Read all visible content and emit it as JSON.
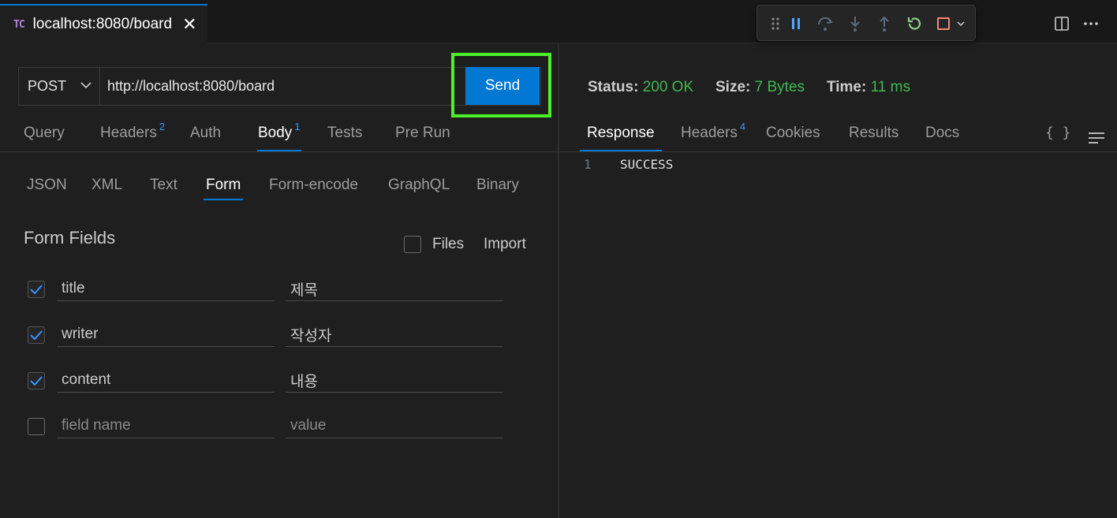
{
  "tab": {
    "badge": "TC",
    "title": "localhost:8080/board",
    "close": "✕"
  },
  "request": {
    "method": "POST",
    "url": "http://localhost:8080/board",
    "send_label": "Send"
  },
  "request_tabs": [
    {
      "label": "Query",
      "count": ""
    },
    {
      "label": "Headers",
      "count": "2"
    },
    {
      "label": "Auth",
      "count": ""
    },
    {
      "label": "Body",
      "count": "1"
    },
    {
      "label": "Tests",
      "count": ""
    },
    {
      "label": "Pre Run",
      "count": ""
    }
  ],
  "active_request_tab": "Body",
  "body_tabs": [
    "JSON",
    "XML",
    "Text",
    "Form",
    "Form-encode",
    "GraphQL",
    "Binary"
  ],
  "active_body_tab": "Form",
  "form": {
    "title": "Form Fields",
    "files_label": "Files",
    "import_label": "Import",
    "fields": [
      {
        "checked": true,
        "name": "title",
        "value": "제목"
      },
      {
        "checked": true,
        "name": "writer",
        "value": "작성자"
      },
      {
        "checked": true,
        "name": "content",
        "value": "내용"
      }
    ],
    "new_field": {
      "name_placeholder": "field name",
      "value_placeholder": "value"
    }
  },
  "response": {
    "status_label": "Status:",
    "status_value": "200 OK",
    "size_label": "Size:",
    "size_value": "7 Bytes",
    "time_label": "Time:",
    "time_value": "11 ms",
    "tabs": [
      {
        "label": "Response",
        "count": ""
      },
      {
        "label": "Headers",
        "count": "4"
      },
      {
        "label": "Cookies",
        "count": ""
      },
      {
        "label": "Results",
        "count": ""
      },
      {
        "label": "Docs",
        "count": ""
      }
    ],
    "active_tab": "Response",
    "braces_label": "{ }",
    "lines": [
      {
        "number": "1",
        "text": "SUCCESS"
      }
    ]
  },
  "colors": {
    "accent": "#0078d4",
    "success": "#3fb950",
    "highlight": "#4bf02a"
  }
}
